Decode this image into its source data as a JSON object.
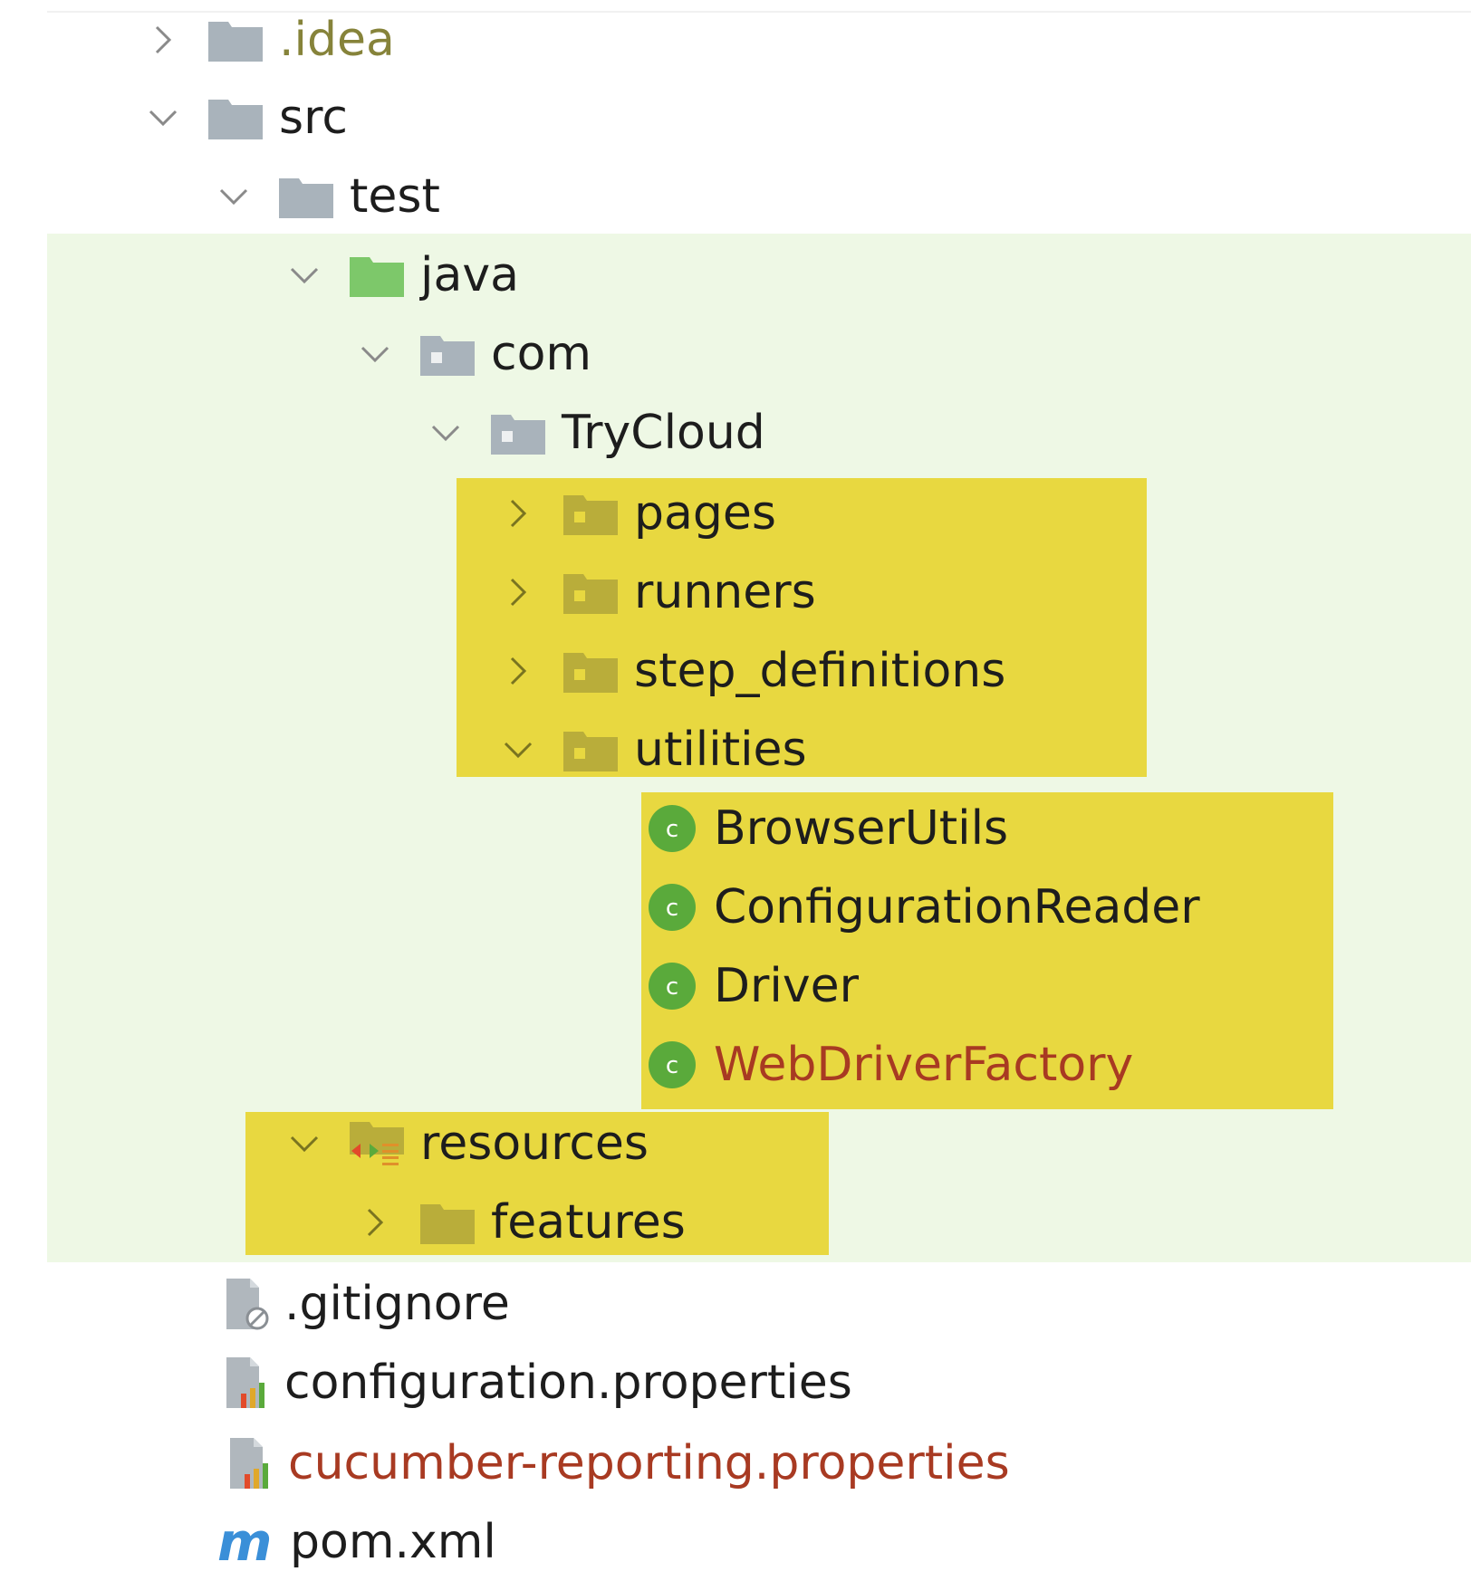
{
  "tree": {
    "idea": {
      "label": ".idea"
    },
    "src": {
      "label": "src"
    },
    "test": {
      "label": "test"
    },
    "java": {
      "label": "java"
    },
    "com": {
      "label": "com"
    },
    "trycloud": {
      "label": "TryCloud"
    },
    "pages": {
      "label": "pages"
    },
    "runners": {
      "label": "runners"
    },
    "step_definitions": {
      "label": "step_definitions"
    },
    "utilities": {
      "label": "utilities"
    },
    "browser_utils": {
      "label": "BrowserUtils"
    },
    "config_reader": {
      "label": "ConfigurationReader"
    },
    "driver": {
      "label": "Driver"
    },
    "webdriver_factory": {
      "label": "WebDriverFactory"
    },
    "resources": {
      "label": "resources"
    },
    "features": {
      "label": "features"
    },
    "gitignore": {
      "label": ".gitignore"
    },
    "config_props": {
      "label": "configuration.properties"
    },
    "cucumber_props": {
      "label": "cucumber-reporting.properties"
    },
    "pom": {
      "label": "pom.xml"
    }
  },
  "colors": {
    "test_sources_bg": "#eef8e5",
    "highlight": "#e8d840",
    "folder_gray": "#a9b3bb",
    "folder_green": "#7dc86a",
    "class_green": "#5aaa3b",
    "modified_red": "#a83a22",
    "excluded_olive": "#86833a"
  },
  "icons": {
    "folder": "folder-icon",
    "test_source_root": "test-source-root-icon",
    "package": "package-icon",
    "class": "class-icon",
    "resources_root": "resources-root-icon",
    "ignore_file": "ignore-file-icon",
    "properties_file": "properties-file-icon",
    "maven_file": "maven-icon"
  }
}
